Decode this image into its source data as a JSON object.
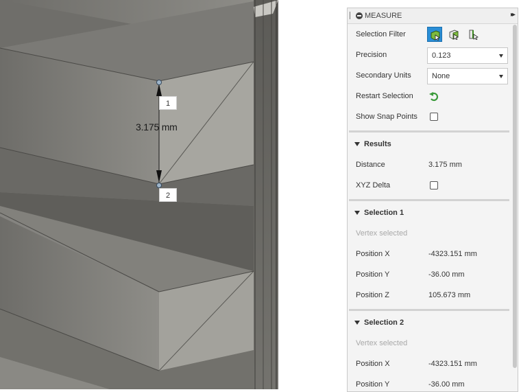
{
  "viewport": {
    "dimension_label": "3.175 mm",
    "point_labels": [
      "1",
      "2"
    ]
  },
  "panel": {
    "title": "MEASURE",
    "expand_glyph": "▸▸",
    "selection_filter": {
      "label": "Selection Filter",
      "options": [
        "select-body-icon",
        "select-face-icon",
        "select-edge-icon"
      ],
      "active_option": "select-body-icon"
    },
    "precision": {
      "label": "Precision",
      "value": "0.123"
    },
    "secondary_units": {
      "label": "Secondary Units",
      "value": "None"
    },
    "restart_selection": {
      "label": "Restart Selection",
      "icon": "restart-icon"
    },
    "show_snap_points": {
      "label": "Show Snap Points",
      "checked": false
    },
    "results": {
      "title": "Results",
      "distance_label": "Distance",
      "distance_value": "3.175 mm",
      "xyz_delta_label": "XYZ Delta",
      "xyz_delta_checked": false
    },
    "selection1": {
      "title": "Selection 1",
      "status": "Vertex selected",
      "pos_x_label": "Position X",
      "pos_x": "-4323.151 mm",
      "pos_y_label": "Position Y",
      "pos_y": "-36.00 mm",
      "pos_z_label": "Position Z",
      "pos_z": "105.673 mm"
    },
    "selection2": {
      "title": "Selection 2",
      "status": "Vertex selected",
      "pos_x_label": "Position X",
      "pos_x": "-4323.151 mm",
      "pos_y_label": "Position Y",
      "pos_y": "-36.00 mm"
    }
  },
  "colors": {
    "active_filter": "#2a8ed6",
    "restart_icon": "#3a9a3a",
    "model_face_light": "#a6a59f",
    "model_face_dark": "#7a7974"
  }
}
